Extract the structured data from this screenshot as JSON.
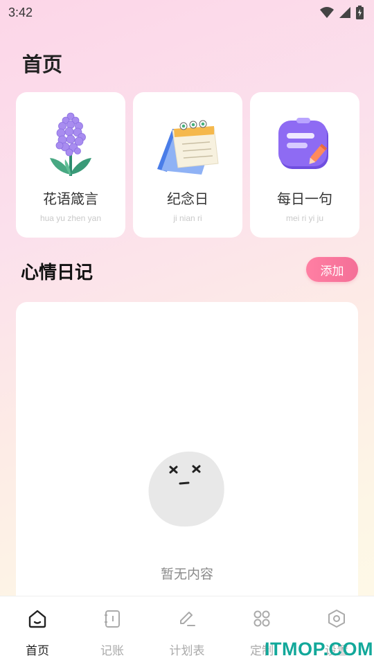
{
  "status_bar": {
    "time": "3:42"
  },
  "page_title": "首页",
  "features": [
    {
      "title": "花语箴言",
      "subtitle": "hua yu zhen yan",
      "icon": "hyacinth-flower-icon"
    },
    {
      "title": "纪念日",
      "subtitle": "ji nian ri",
      "icon": "desk-calendar-icon"
    },
    {
      "title": "每日一句",
      "subtitle": "mei ri yi ju",
      "icon": "notebook-pen-icon"
    }
  ],
  "diary": {
    "title": "心情日记",
    "add_label": "添加",
    "empty_text": "暂无内容"
  },
  "tabs": [
    {
      "label": "首页",
      "icon": "home-icon",
      "active": true
    },
    {
      "label": "记账",
      "icon": "ledger-icon",
      "active": false
    },
    {
      "label": "计划表",
      "icon": "edit-pen-icon",
      "active": false
    },
    {
      "label": "定制",
      "icon": "grid-apps-icon",
      "active": false
    },
    {
      "label": "设置",
      "icon": "hexagon-settings-icon",
      "active": false
    }
  ],
  "watermark": "ITMOP.COM",
  "colors": {
    "accent": "#f46f97",
    "purple": "#7b5cf0",
    "watermark": "#12a89a"
  }
}
